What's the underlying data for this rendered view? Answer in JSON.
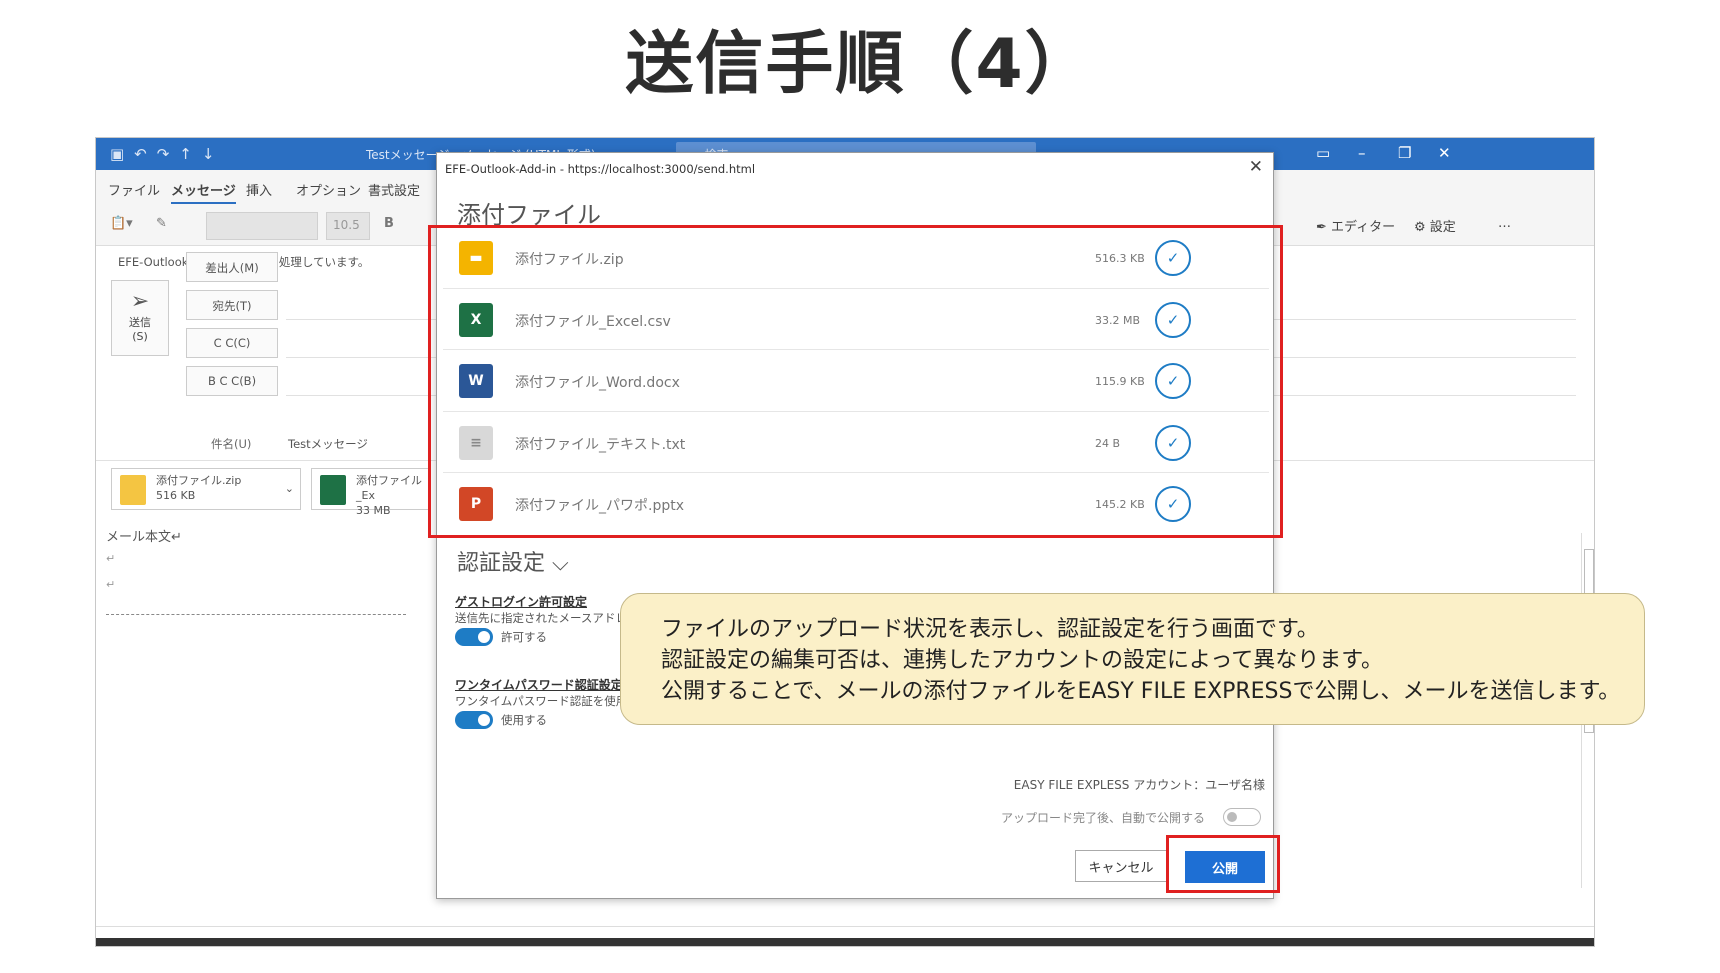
{
  "slide": {
    "title": "送信手順（4）"
  },
  "outlook": {
    "window_title": "Testメッセージ - メッセージ (HTML 形式)",
    "search_placeholder": "検索",
    "menu": [
      "ファイル",
      "メッセージ",
      "挿入",
      "オプション",
      "書式設定"
    ],
    "active_menu": "メッセージ",
    "ribbon": {
      "font_size": "10.5",
      "bold": "B",
      "editor": "エディター",
      "settings": "設定",
      "more": "…"
    },
    "notice": "EFE-Outlook-Add-in が要求を処理しています。",
    "send_button": {
      "label": "送信",
      "shortcut": "(S)"
    },
    "fields": {
      "from": "差出人(M)",
      "to": "宛先(T)",
      "cc": "C C(C)",
      "bcc": "B C C(B)"
    },
    "subject_label": "件名(U)",
    "subject_value": "Testメッセージ",
    "attachments": [
      {
        "name": "添付ファイル.zip",
        "size": "516 KB"
      },
      {
        "name": "添付ファイル_Ex",
        "size": "33 MB"
      }
    ],
    "body_text": "メール本文↵"
  },
  "dialog": {
    "url": "EFE-Outlook-Add-in - https://localhost:3000/send.html",
    "heading": "添付ファイル",
    "files": [
      {
        "name": "添付ファイル.zip",
        "size": "516.3 KB",
        "icon": "zip-icon",
        "color": "#f4b400",
        "glyph": "▬"
      },
      {
        "name": "添付ファイル_Excel.csv",
        "size": "33.2 MB",
        "icon": "excel-icon",
        "color": "#1e7145",
        "glyph": "X"
      },
      {
        "name": "添付ファイル_Word.docx",
        "size": "115.9 KB",
        "icon": "word-icon",
        "color": "#2b5797",
        "glyph": "W"
      },
      {
        "name": "添付ファイル_テキスト.txt",
        "size": "24 B",
        "icon": "text-file-icon",
        "color": "#d8d8d8",
        "glyph": "≡"
      },
      {
        "name": "添付ファイル_パワポ.pptx",
        "size": "145.2 KB",
        "icon": "powerpoint-icon",
        "color": "#d24726",
        "glyph": "P"
      }
    ],
    "auth": {
      "heading": "認証設定",
      "guest": {
        "title": "ゲストログイン許可設定",
        "desc": "送信先に指定されたメースアドレス",
        "toggle_label": "許可する"
      },
      "otp": {
        "title": "ワンタイムパスワード認証設定",
        "desc": "ワンタイムパスワード認証を使用する",
        "toggle_label": "使用する"
      }
    },
    "account": "EASY FILE EXPLESS アカウント：ユーザ名様",
    "auto_publish": "アップロード完了後、自動で公開する",
    "cancel": "キャンセル",
    "publish": "公開"
  },
  "callout": {
    "lines": [
      "ファイルのアップロード状況を表示し、認証設定を行う画面です。",
      "認証設定の編集可否は、連携したアカウントの設定によって異なります。",
      "公開することで、メールの添付ファイルをEASY FILE EXPRESSで公開し、メールを送信します。"
    ]
  },
  "colors": {
    "accent": "#1e6fd4",
    "highlight": "#e02020",
    "callout_bg": "#fbf0c8",
    "outlook_blue": "#2b6fc2"
  }
}
